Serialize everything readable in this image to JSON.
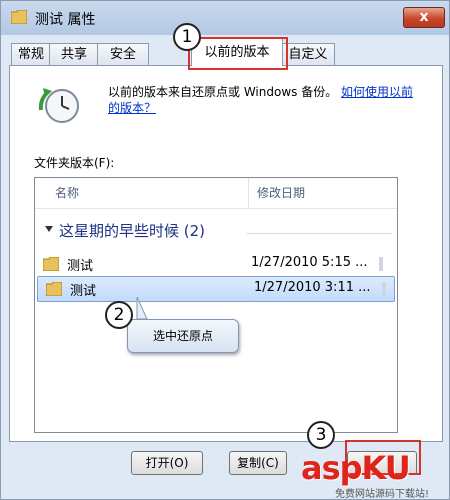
{
  "window": {
    "title": "测试 属性",
    "close_label": "x"
  },
  "tabs": [
    {
      "label": "常规"
    },
    {
      "label": "共享"
    },
    {
      "label": "安全"
    },
    {
      "label": "以前的版本",
      "active": true
    },
    {
      "label": "自定义"
    }
  ],
  "info": {
    "description": "以前的版本来自还原点或 Windows 备份。",
    "link": "如何使用以前的版本？"
  },
  "folder_versions": {
    "label": "文件夹版本(F):",
    "columns": {
      "name": "名称",
      "date": "修改日期"
    },
    "group": {
      "title": "这星期的早些时候 (2)"
    },
    "rows": [
      {
        "name": "测试",
        "date": "1/27/2010 5:15 ...",
        "selected": false
      },
      {
        "name": "测试",
        "date": "1/27/2010 3:11 ...",
        "selected": true
      }
    ]
  },
  "callout": {
    "text": "选中还原点"
  },
  "steps": [
    "1",
    "2",
    "3"
  ],
  "buttons": {
    "open": "打开(O)",
    "copy": "复制(C)"
  },
  "watermark": {
    "logo": "aspKU",
    "sub": "免费网站源码下载站!"
  },
  "colors": {
    "highlight": "#d6332a",
    "link": "#0033cc",
    "group_header": "#1e3287"
  }
}
